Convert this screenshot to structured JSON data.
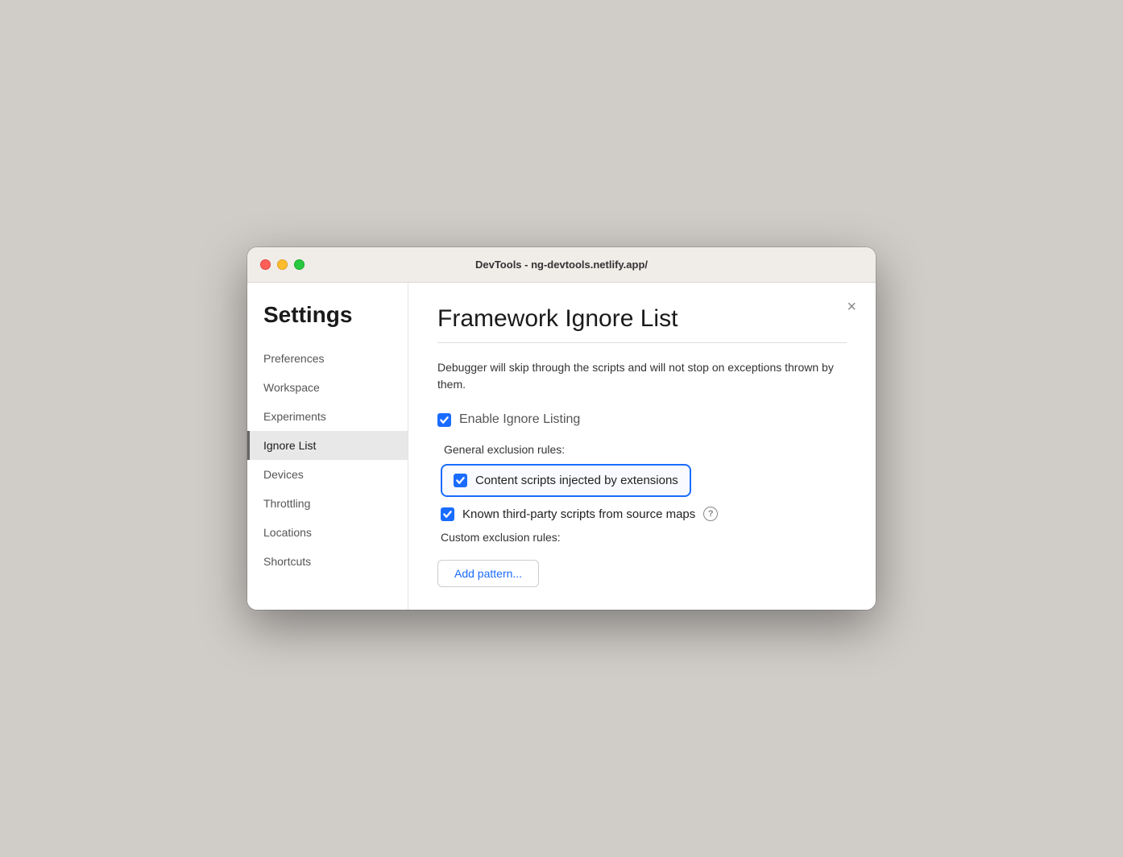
{
  "window": {
    "title": "DevTools - ng-devtools.netlify.app/"
  },
  "sidebar": {
    "heading": "Settings",
    "items": [
      {
        "id": "preferences",
        "label": "Preferences",
        "active": false
      },
      {
        "id": "workspace",
        "label": "Workspace",
        "active": false
      },
      {
        "id": "experiments",
        "label": "Experiments",
        "active": false
      },
      {
        "id": "ignore-list",
        "label": "Ignore List",
        "active": true
      },
      {
        "id": "devices",
        "label": "Devices",
        "active": false
      },
      {
        "id": "throttling",
        "label": "Throttling",
        "active": false
      },
      {
        "id": "locations",
        "label": "Locations",
        "active": false
      },
      {
        "id": "shortcuts",
        "label": "Shortcuts",
        "active": false
      }
    ]
  },
  "main": {
    "title": "Framework Ignore List",
    "description": "Debugger will skip through the scripts and will not stop on exceptions thrown by them.",
    "close_label": "×",
    "enable_ignore_listing_label": "Enable Ignore Listing",
    "general_exclusion_label": "General exclusion rules:",
    "rules": [
      {
        "id": "content-scripts",
        "label": "Content scripts injected by extensions",
        "checked": true,
        "highlighted": true,
        "has_help": false
      },
      {
        "id": "third-party-scripts",
        "label": "Known third-party scripts from source maps",
        "checked": true,
        "highlighted": false,
        "has_help": true
      }
    ],
    "custom_exclusion_label": "Custom exclusion rules:",
    "add_pattern_label": "Add pattern..."
  }
}
